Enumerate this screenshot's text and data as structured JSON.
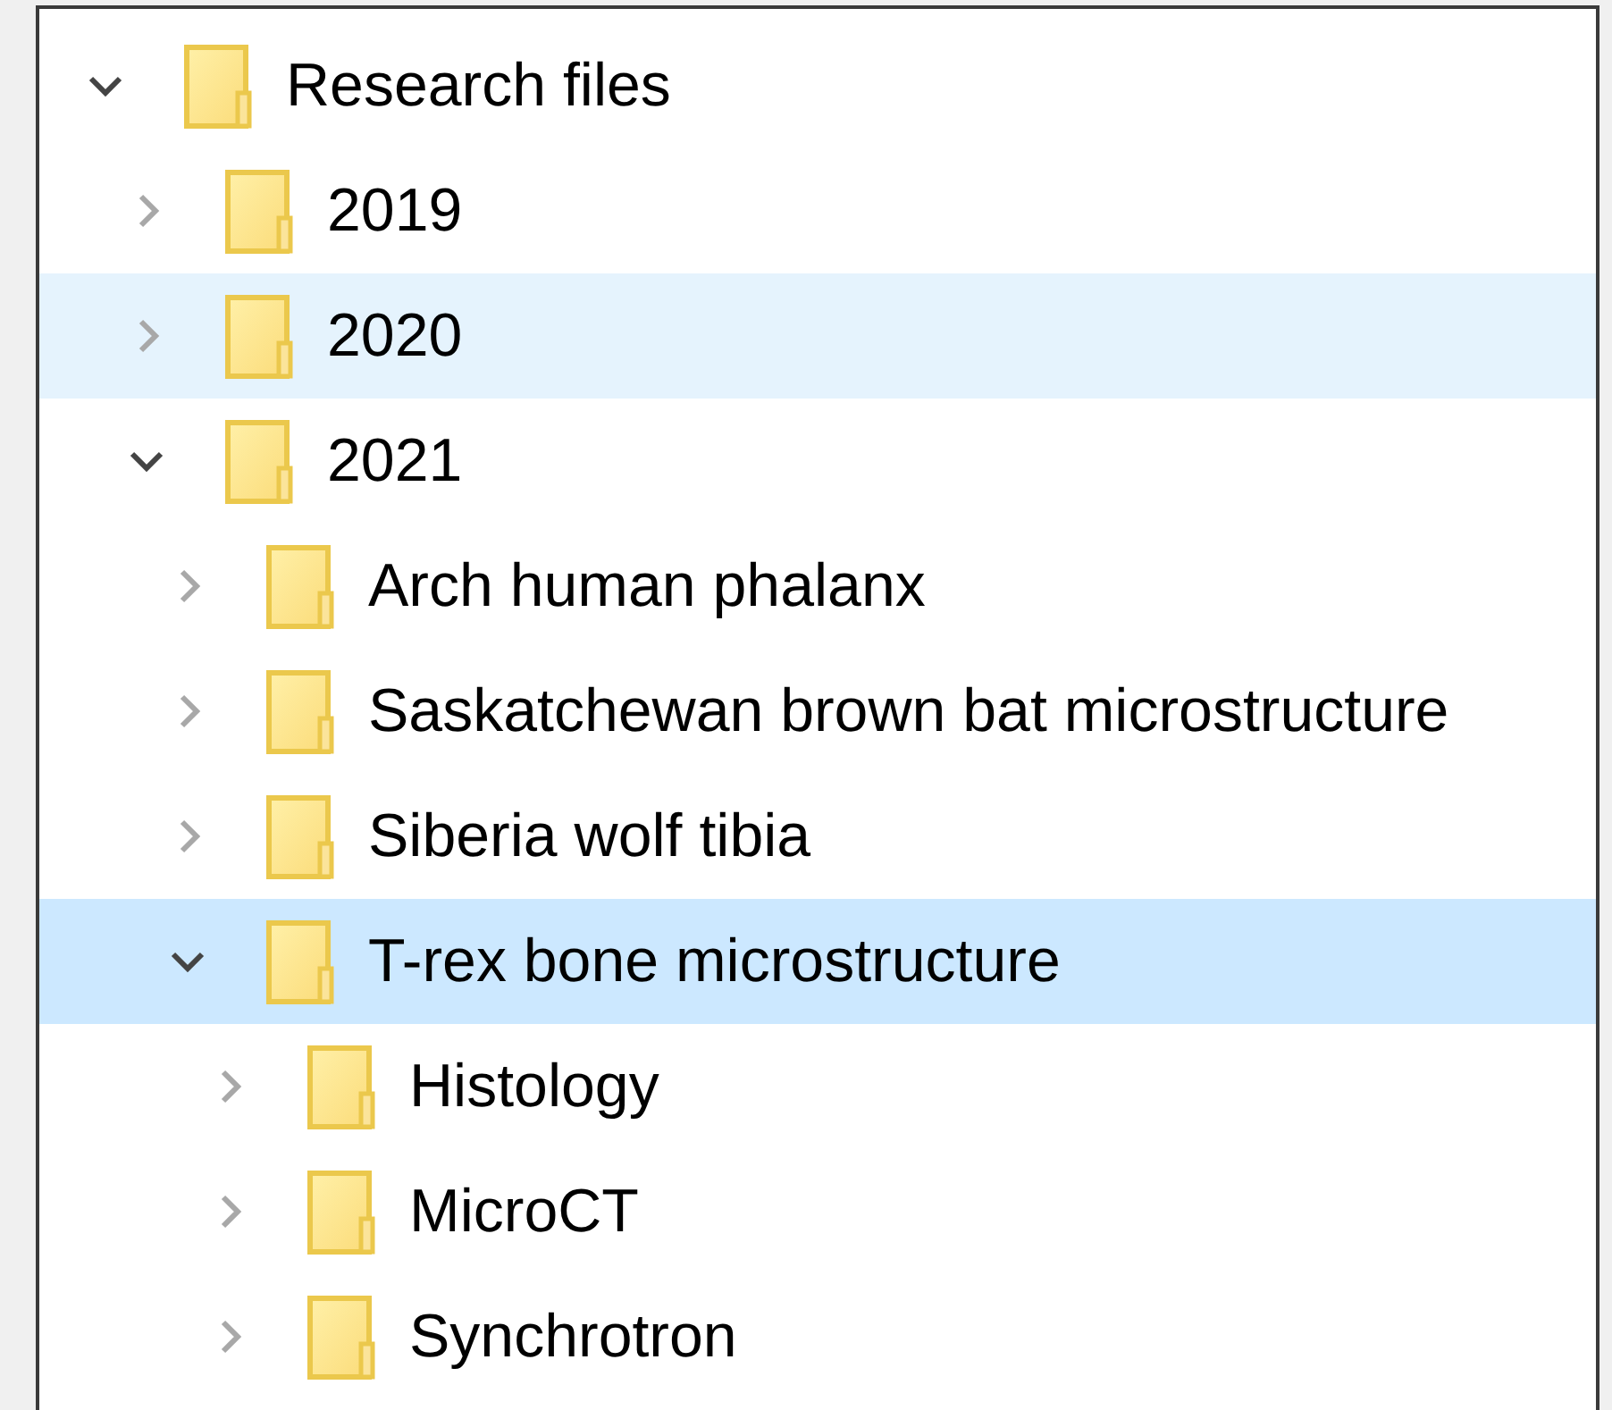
{
  "tree": [
    {
      "label": "Research files",
      "expanded": true,
      "selected": false,
      "hovered": false,
      "children": [
        {
          "label": "2019",
          "expanded": false,
          "selected": false,
          "hovered": false
        },
        {
          "label": "2020",
          "expanded": false,
          "selected": false,
          "hovered": true
        },
        {
          "label": "2021",
          "expanded": true,
          "selected": false,
          "hovered": false,
          "children": [
            {
              "label": "Arch human phalanx",
              "expanded": false,
              "selected": false,
              "hovered": false
            },
            {
              "label": "Saskatchewan brown bat microstructure",
              "expanded": false,
              "selected": false,
              "hovered": false
            },
            {
              "label": "Siberia wolf tibia",
              "expanded": false,
              "selected": false,
              "hovered": false
            },
            {
              "label": "T-rex bone microstructure",
              "expanded": true,
              "selected": true,
              "hovered": false,
              "children": [
                {
                  "label": "Histology",
                  "expanded": false,
                  "selected": false,
                  "hovered": false
                },
                {
                  "label": "MicroCT",
                  "expanded": false,
                  "selected": false,
                  "hovered": false
                },
                {
                  "label": "Synchrotron",
                  "expanded": false,
                  "selected": false,
                  "hovered": false
                }
              ]
            }
          ]
        }
      ]
    }
  ]
}
